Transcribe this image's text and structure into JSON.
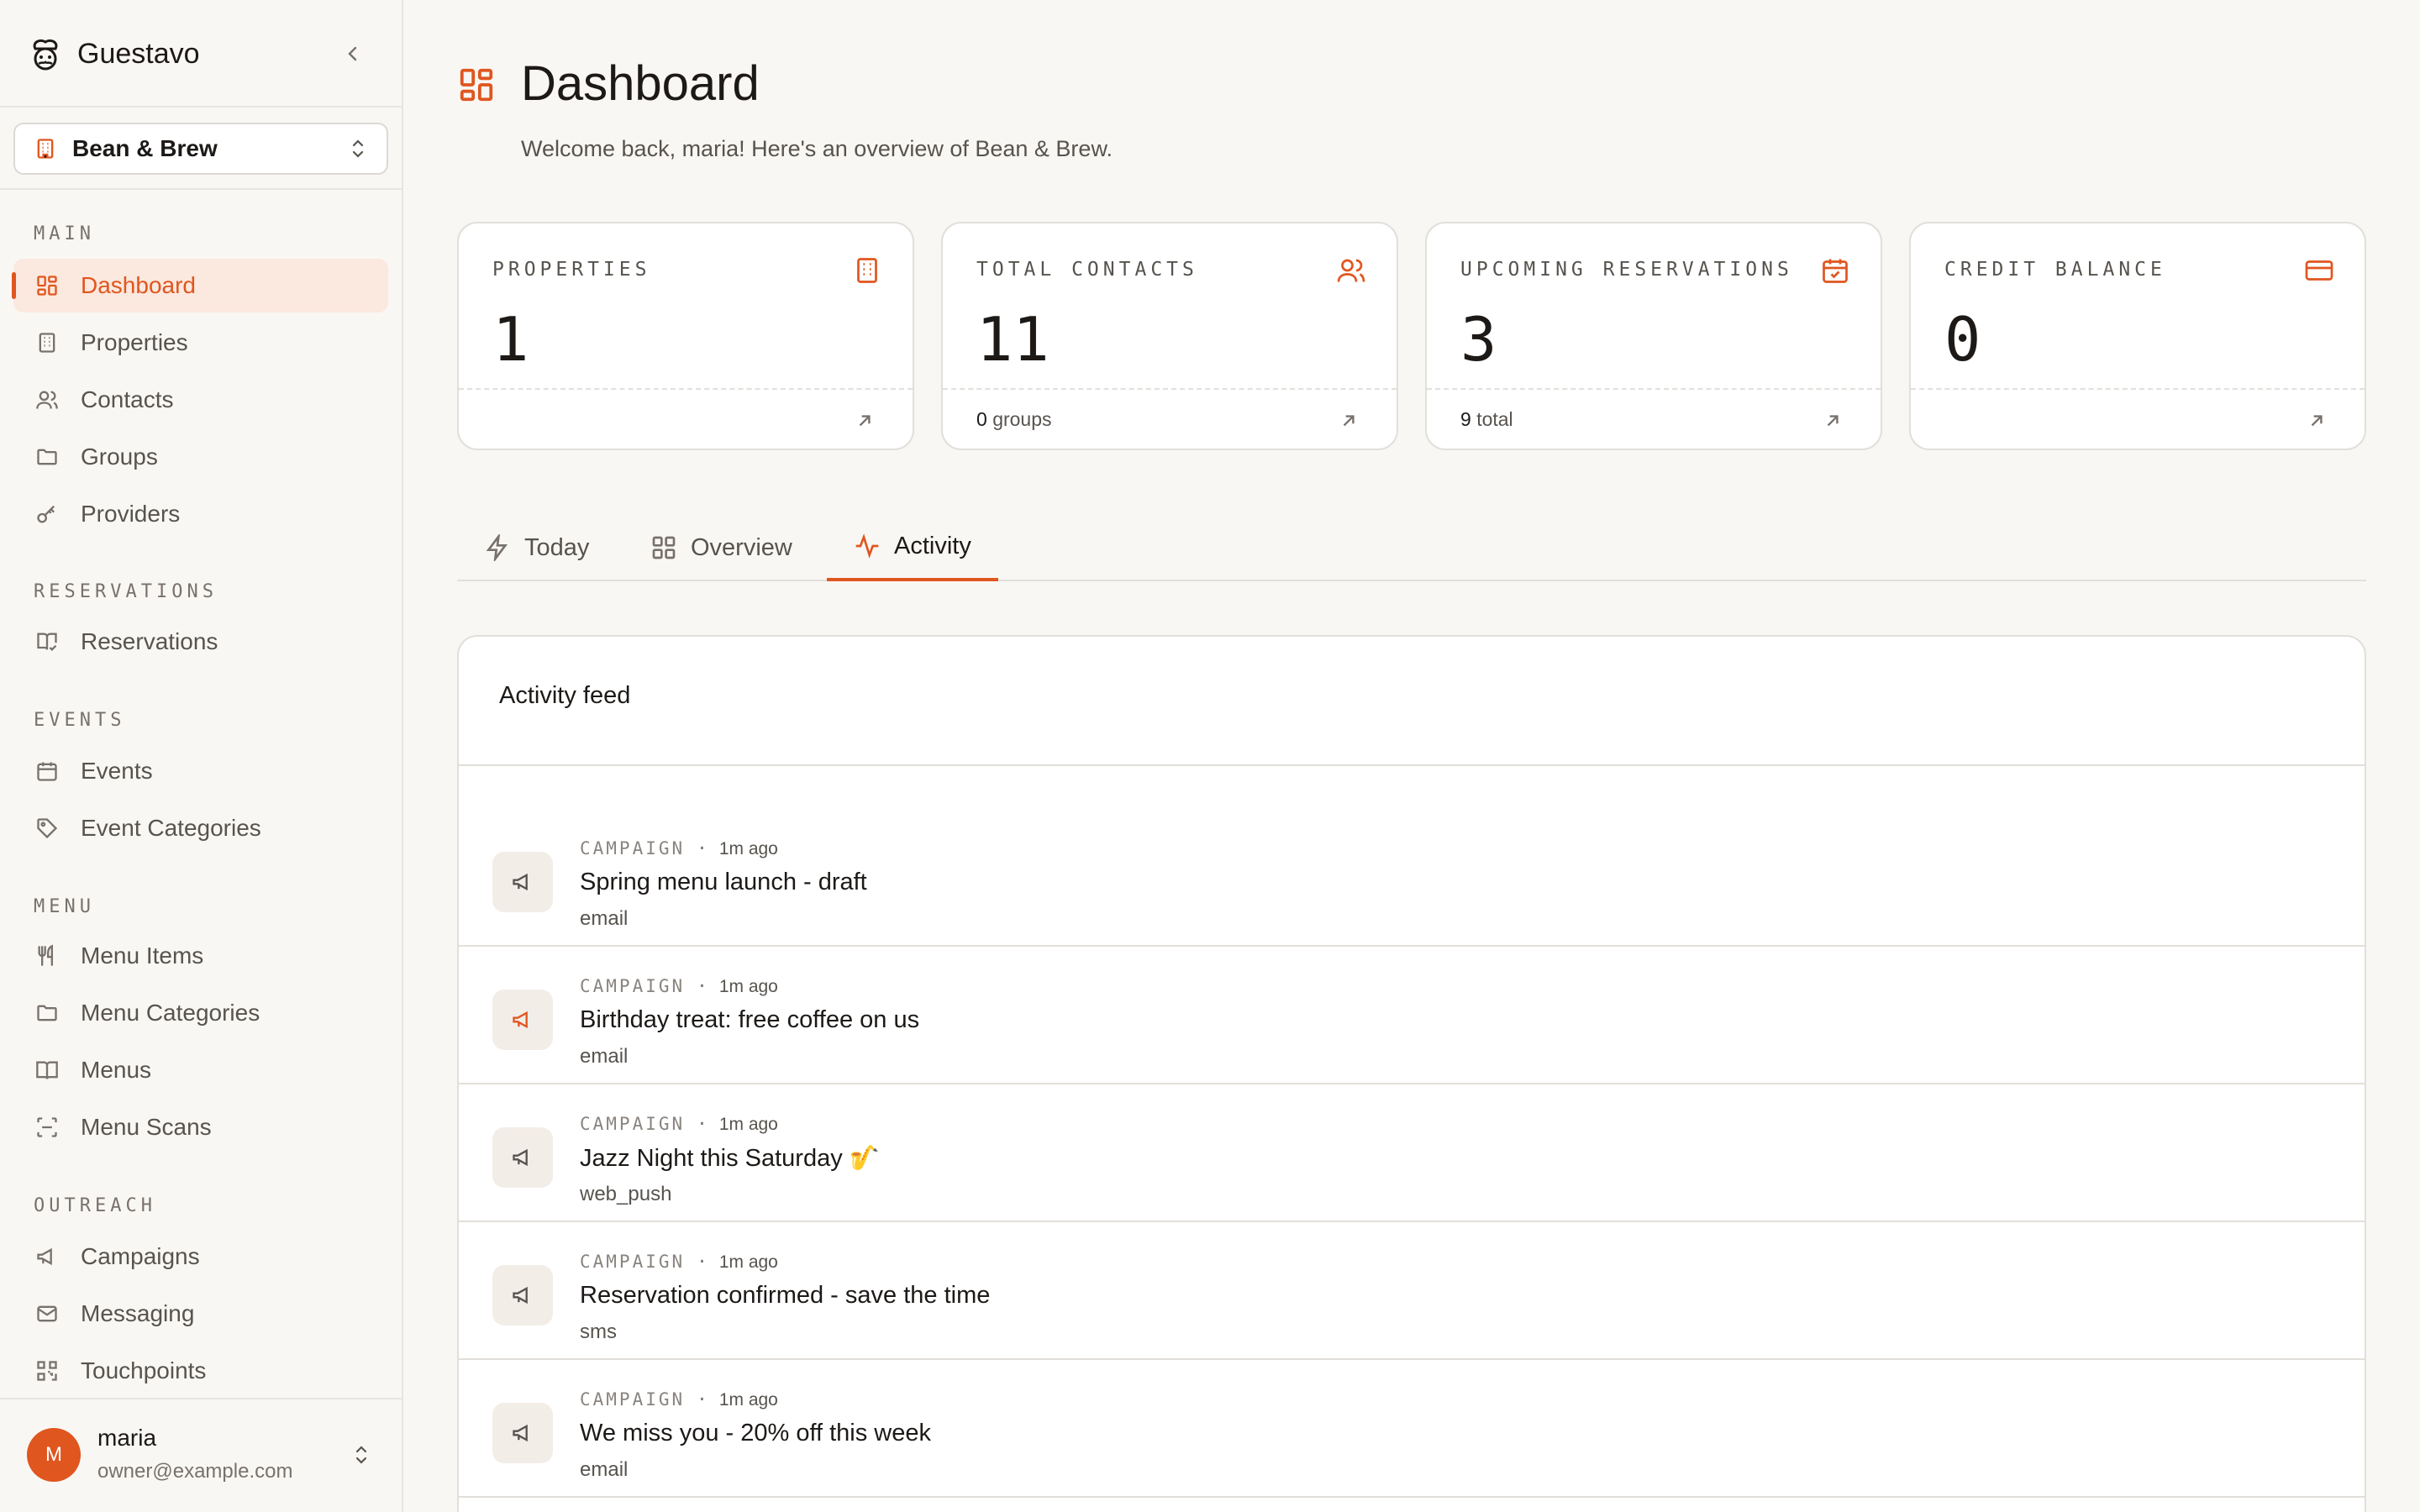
{
  "app": {
    "name": "Guestavo"
  },
  "org": {
    "name": "Bean & Brew"
  },
  "sidebar": {
    "groups": [
      {
        "label": "MAIN",
        "items": [
          {
            "label": "Dashboard",
            "icon": "layout-grid-icon",
            "active": true
          },
          {
            "label": "Properties",
            "icon": "building-icon"
          },
          {
            "label": "Contacts",
            "icon": "users-icon"
          },
          {
            "label": "Groups",
            "icon": "folder-icon"
          },
          {
            "label": "Providers",
            "icon": "key-icon"
          }
        ]
      },
      {
        "label": "RESERVATIONS",
        "items": [
          {
            "label": "Reservations",
            "icon": "book-open-check-icon"
          }
        ]
      },
      {
        "label": "EVENTS",
        "items": [
          {
            "label": "Events",
            "icon": "calendar-icon"
          },
          {
            "label": "Event Categories",
            "icon": "tag-icon"
          }
        ]
      },
      {
        "label": "MENU",
        "items": [
          {
            "label": "Menu Items",
            "icon": "utensils-icon"
          },
          {
            "label": "Menu Categories",
            "icon": "folder-icon"
          },
          {
            "label": "Menus",
            "icon": "book-icon"
          },
          {
            "label": "Menu Scans",
            "icon": "scan-icon"
          }
        ]
      },
      {
        "label": "OUTREACH",
        "items": [
          {
            "label": "Campaigns",
            "icon": "megaphone-icon"
          },
          {
            "label": "Messaging",
            "icon": "mail-icon"
          },
          {
            "label": "Touchpoints",
            "icon": "qr-code-icon"
          }
        ]
      }
    ]
  },
  "user": {
    "initial": "M",
    "name": "maria",
    "email": "owner@example.com"
  },
  "header": {
    "title": "Dashboard",
    "subtitle": "Welcome back, maria! Here's an overview of Bean & Brew."
  },
  "stats": [
    {
      "label": "PROPERTIES",
      "value": "1",
      "foot_value": "",
      "foot_label": "",
      "icon": "building-icon"
    },
    {
      "label": "TOTAL CONTACTS",
      "value": "11",
      "foot_value": "0",
      "foot_label": "groups",
      "icon": "users-icon"
    },
    {
      "label": "UPCOMING RESERVATIONS",
      "value": "3",
      "foot_value": "9",
      "foot_label": "total",
      "icon": "calendar-check-icon"
    },
    {
      "label": "CREDIT BALANCE",
      "value": "0",
      "foot_value": "",
      "foot_label": "",
      "icon": "credit-card-icon"
    }
  ],
  "tabs": [
    {
      "label": "Today",
      "icon": "zap-icon"
    },
    {
      "label": "Overview",
      "icon": "layout-grid-icon"
    },
    {
      "label": "Activity",
      "icon": "activity-icon",
      "active": true
    }
  ],
  "feed": {
    "title": "Activity feed",
    "items": [
      {
        "kind": "CAMPAIGN",
        "time": "1m ago",
        "title": "Spring menu launch - draft",
        "channel": "email"
      },
      {
        "kind": "CAMPAIGN",
        "time": "1m ago",
        "title": "Birthday treat: free coffee on us",
        "channel": "email",
        "highlight": true
      },
      {
        "kind": "CAMPAIGN",
        "time": "1m ago",
        "title": "Jazz Night this Saturday 🎷",
        "channel": "web_push"
      },
      {
        "kind": "CAMPAIGN",
        "time": "1m ago",
        "title": "Reservation confirmed - save the time",
        "channel": "sms"
      },
      {
        "kind": "CAMPAIGN",
        "time": "1m ago",
        "title": "We miss you - 20% off this week",
        "channel": "email"
      }
    ]
  },
  "colors": {
    "accent": "#e0561f",
    "background": "#f9f7f4",
    "border": "#e2dfda",
    "active_bg": "#fbe8de"
  }
}
